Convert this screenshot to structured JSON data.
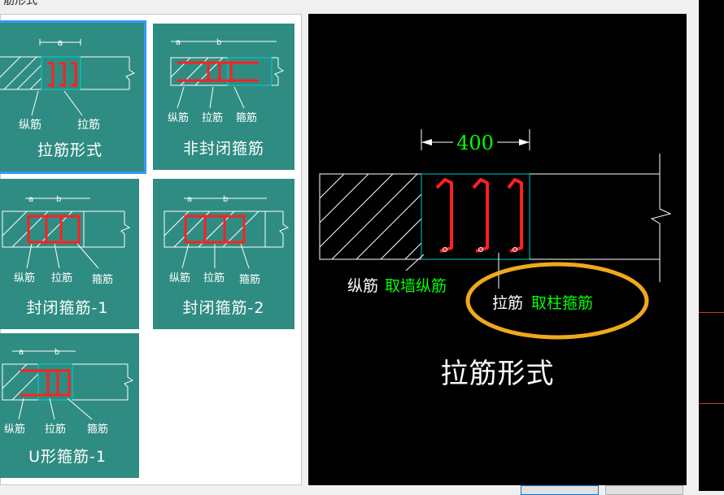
{
  "header": {
    "title": "筋形式"
  },
  "tiles": [
    {
      "label": "拉筋形式",
      "dim": "a",
      "note1": "纵筋",
      "note2": "拉筋",
      "note3": ""
    },
    {
      "label": "非封闭箍筋",
      "dim_a": "a",
      "dim_b": "b",
      "note1": "纵筋",
      "note2": "拉筋",
      "note3": "箍筋"
    },
    {
      "label": "封闭箍筋-1",
      "dim_a": "a",
      "dim_b": "b",
      "note1": "纵筋",
      "note2": "拉筋",
      "note3": "箍筋"
    },
    {
      "label": "封闭箍筋-2",
      "dim_a": "a",
      "dim_b": "b",
      "note1": "纵筋",
      "note2": "拉筋",
      "note3": "箍筋"
    },
    {
      "label": "U形箍筋-1",
      "dim_a": "a",
      "dim_b": "b",
      "note1": "纵筋",
      "note2": "拉筋",
      "note3": "箍筋"
    }
  ],
  "preview": {
    "dimension": "400",
    "label_long_a": "纵筋",
    "label_long_b": "取墙纵筋",
    "label_tie_a": "拉筋",
    "label_tie_b": "取柱箍筋",
    "title": "拉筋形式"
  },
  "colors": {
    "tile_bg": "#2f8c82",
    "rebar": "#ff2020",
    "cyan": "#00c8c8",
    "highlight": "#f0a81c",
    "dim_green": "#00ff00"
  }
}
